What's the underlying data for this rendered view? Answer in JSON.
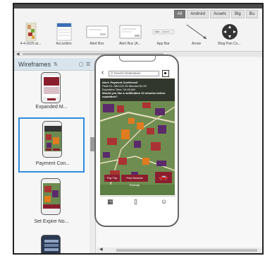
{
  "filters": [
    "All",
    "Android",
    "Assets",
    "Big",
    "Bu"
  ],
  "components": [
    {
      "label": "4-4-2020 at...",
      "icon": "map-thumbnail"
    },
    {
      "label": "Accordion",
      "icon": "accordion-thumbnail"
    },
    {
      "label": "Alert Box",
      "icon": "alert-box-thumbnail"
    },
    {
      "label": "Alert Box (A...",
      "icon": "alert-box-android-thumbnail"
    },
    {
      "label": "App Bar",
      "icon": "app-bar-thumbnail"
    },
    {
      "label": "Arrow",
      "icon": "arrow-thumbnail"
    },
    {
      "label": "Bing Pan Co...",
      "icon": "pan-control-thumbnail"
    }
  ],
  "panel": {
    "title": "Wireframes",
    "wireframes": [
      {
        "label": "Expanded M..."
      },
      {
        "label": "Payment Con..."
      },
      {
        "label": "Set Expire No..."
      },
      {
        "label": ""
      }
    ]
  },
  "phone": {
    "search_placeholder": "Search Destination",
    "notice_title": "Alert: Payment Confirmed!",
    "notice_line1": "Plate ID: ABC123 30 Minutes $1.00",
    "notice_line2": "Expiration Time: 10:45 AM",
    "notice_line3": "Would you like a notification 10 minutes before expiration?",
    "btn_pay": "Pay Trip",
    "btn_find": "Find Nearest Parking!",
    "colors": {
      "accent": "#8b1e2e",
      "selection": "#2f8ce0"
    }
  }
}
